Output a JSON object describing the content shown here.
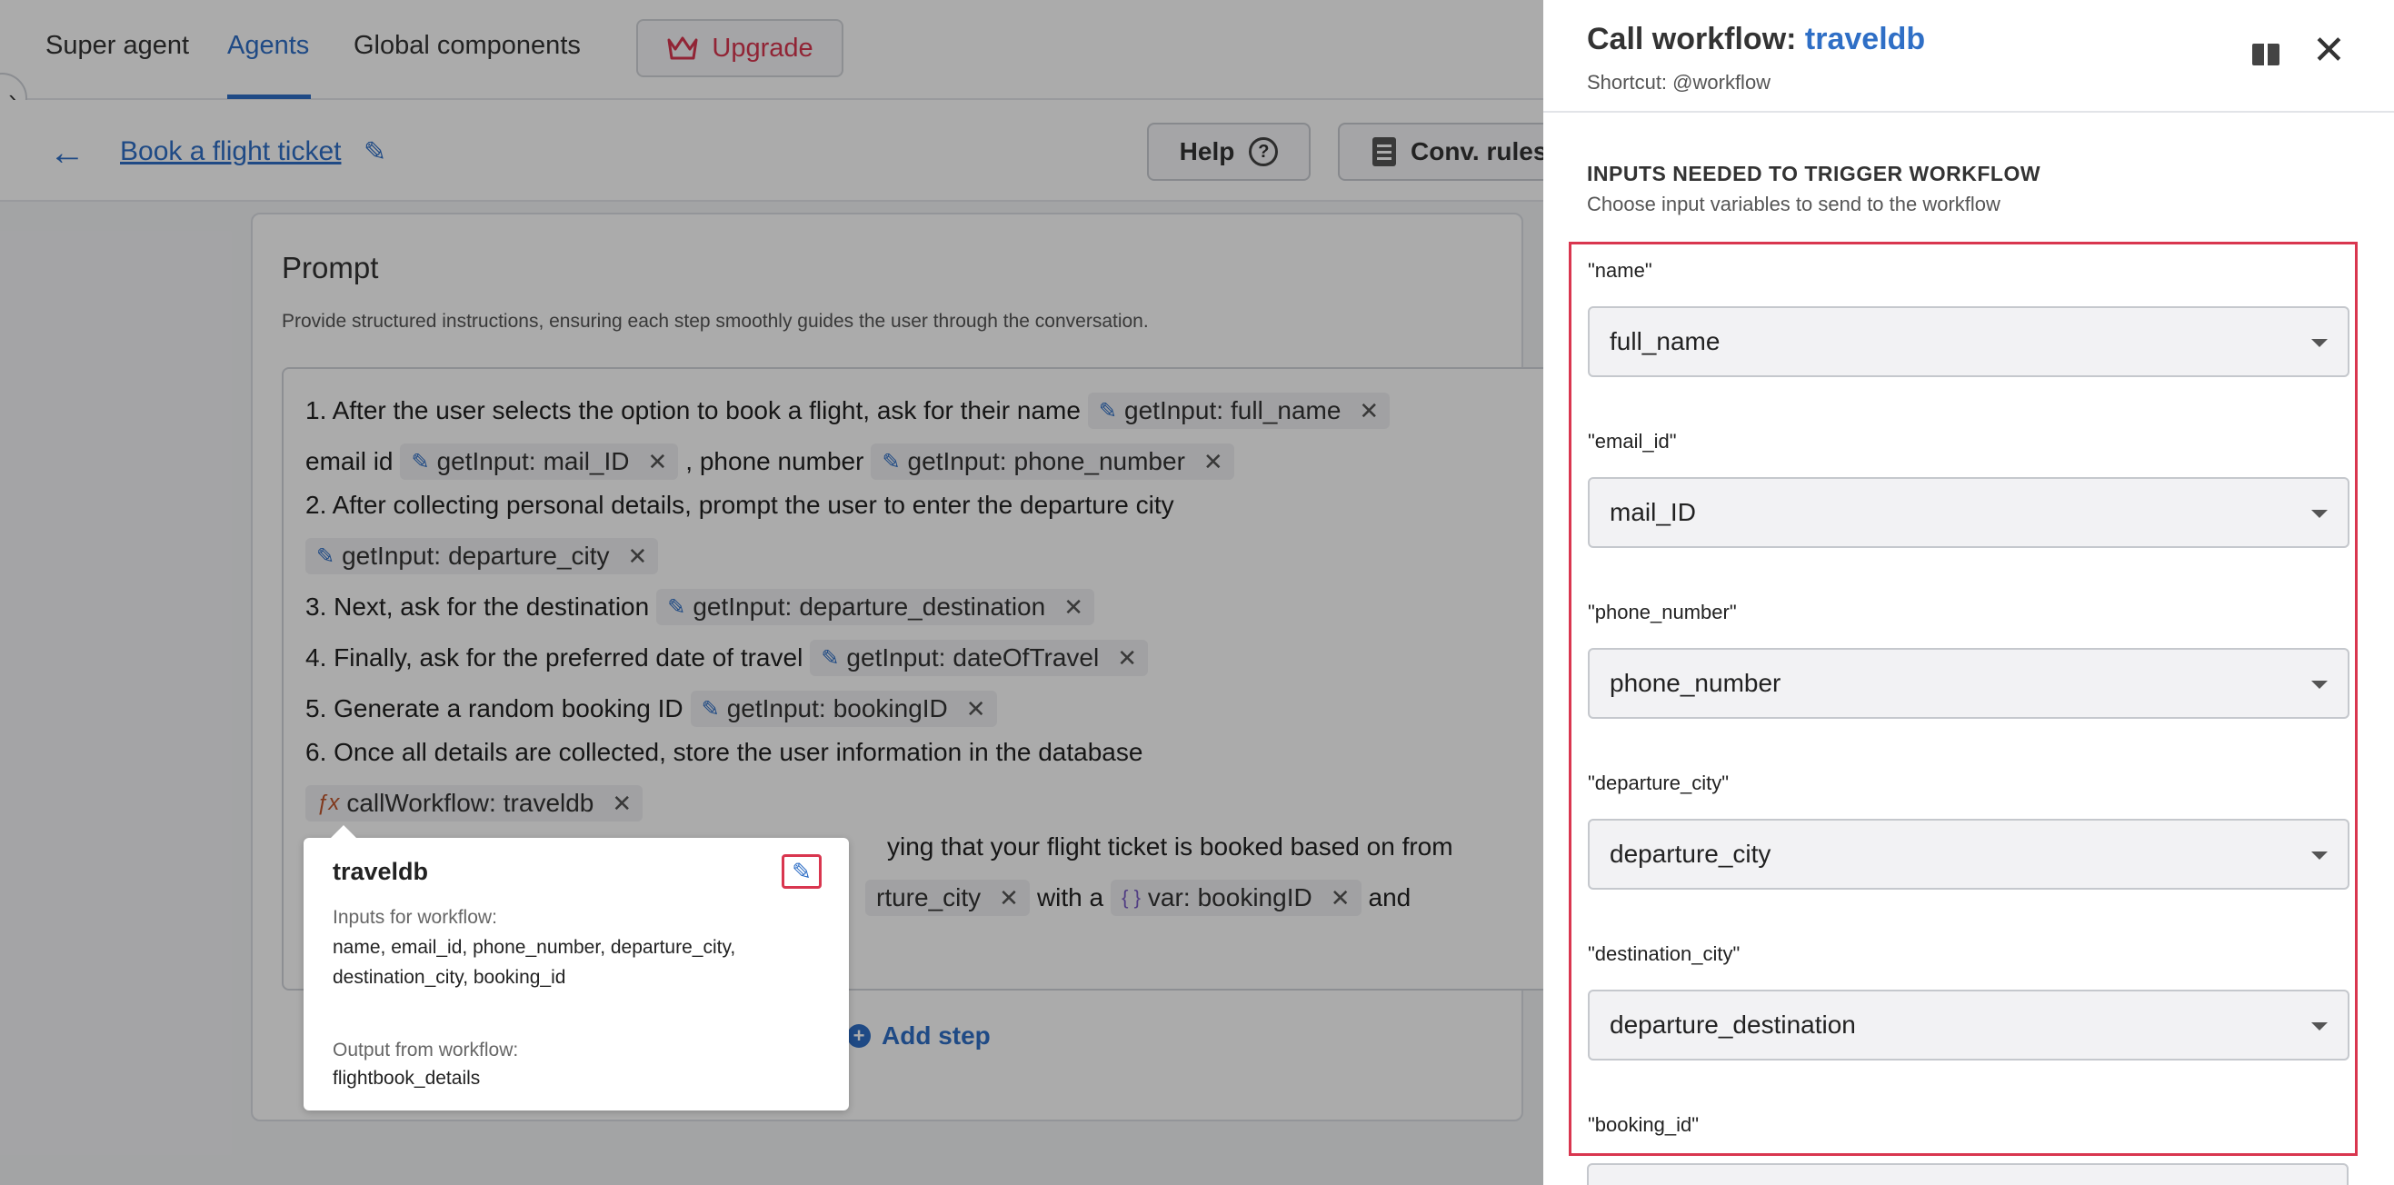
{
  "topnav": {
    "tabs": [
      "Super agent",
      "Agents",
      "Global components"
    ],
    "active_tab": "Agents",
    "upgrade_label": "Upgrade"
  },
  "subbar": {
    "agent_title": "Book a flight ticket",
    "help_label": "Help",
    "conv_rules_label": "Conv. rules"
  },
  "prompt": {
    "title": "Prompt",
    "description": "Provide structured instructions, ensuring each step smoothly guides the user through the conversation.",
    "line1_text": "1. After the user selects the option to book a flight, ask for their name",
    "line1_chip": {
      "kind": "getInput:",
      "value": "full_name"
    },
    "line2_pre": "email id",
    "line2_chip1": {
      "kind": "getInput:",
      "value": "mail_ID"
    },
    "line2_mid": ", phone number",
    "line2_chip2": {
      "kind": "getInput:",
      "value": "phone_number"
    },
    "line3_text": "2. After collecting personal details, prompt the user to enter the departure city",
    "line4_chip": {
      "kind": "getInput:",
      "value": "departure_city"
    },
    "line5_text": "3. Next, ask for the destination",
    "line5_chip": {
      "kind": "getInput:",
      "value": "departure_destination"
    },
    "line6_text": "4. Finally, ask for the preferred date of travel",
    "line6_chip": {
      "kind": "getInput:",
      "value": "dateOfTravel"
    },
    "line7_text": "5. Generate a random booking ID",
    "line7_chip": {
      "kind": "getInput:",
      "value": "bookingID"
    },
    "line8_text": "6. Once all details are collected, store the user information in the database",
    "line9_chip": {
      "kind": "callWorkflow:",
      "value": "traveldb"
    },
    "line10_text": "ying that your flight ticket is booked based on from",
    "line11_chip_tail": "rture_city",
    "line11_mid": "with a",
    "line11_chip2": {
      "kind": "var:",
      "value": "bookingID"
    },
    "line11_end": "and",
    "add_step_label": "Add step"
  },
  "popover": {
    "title": "traveldb",
    "inputs_label": "Inputs for workflow:",
    "inputs_value": "name, email_id, phone_number, departure_city, destination_city, booking_id",
    "output_label": "Output from workflow:",
    "output_value": "flightbook_details"
  },
  "panel": {
    "title_prefix": "Call workflow:",
    "title_link": "traveldb",
    "shortcut": "Shortcut: @workflow",
    "section_title": "INPUTS NEEDED TO TRIGGER WORKFLOW",
    "section_desc": "Choose input variables to send to the workflow",
    "fields": [
      {
        "label": "\"name\"",
        "value": "full_name"
      },
      {
        "label": "\"email_id\"",
        "value": "mail_ID"
      },
      {
        "label": "\"phone_number\"",
        "value": "phone_number"
      },
      {
        "label": "\"departure_city\"",
        "value": "departure_city"
      },
      {
        "label": "\"destination_city\"",
        "value": "departure_destination"
      },
      {
        "label": "\"booking_id\"",
        "value": ""
      }
    ]
  },
  "colors": {
    "accent": "#2f6fc6",
    "highlight": "#d9364f"
  }
}
